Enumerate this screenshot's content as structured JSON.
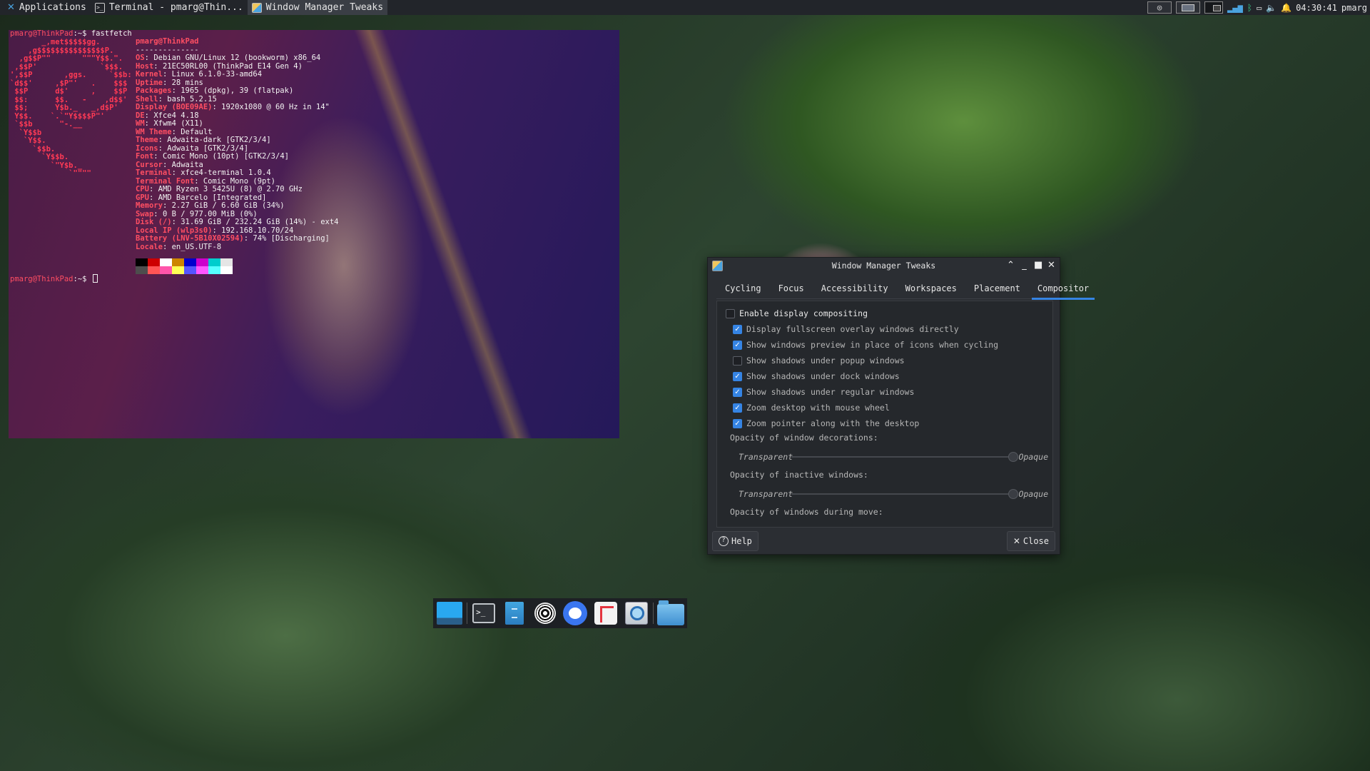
{
  "top_panel": {
    "applications": "Applications",
    "tasks": [
      {
        "label": "Terminal - pmarg@Thin...",
        "icon": "terminal-icon"
      },
      {
        "label": "Window Manager Tweaks",
        "icon": "window-manager-tweaks-icon"
      }
    ],
    "clock": "04:30:41",
    "user": "pmarg"
  },
  "terminal": {
    "prompt": "pmarg@ThinkPad",
    "path": ":~$",
    "command": "fastfetch",
    "logo": "       _,met$$$$$gg.\n    ,g$$$$$$$$$$$$$$$P.\n  ,g$$P\"\"       \"\"\"Y$$.\".\n ,$$P'              `$$$.\n',$$P       ,ggs.     `$$b:\n`d$$'     ,$P\"'   .    $$$\n $$P      d$'     ,    $$P\n $$:      $$.   -    ,d$$'\n $$;      Y$b._   _,d$P'\n Y$$.    `.`\"Y$$$$P\"'\n `$$b      \"-.__\n  `Y$$b\n   `Y$$.\n     `$$b.\n       `Y$$b.\n         `\"Y$b._\n             `\"\"\"\"",
    "user_host": "pmarg@ThinkPad",
    "separator": "--------------",
    "info": [
      {
        "key": "OS",
        "value": "Debian GNU/Linux 12 (bookworm) x86_64"
      },
      {
        "key": "Host",
        "value": "21EC50RL00 (ThinkPad E14 Gen 4)"
      },
      {
        "key": "Kernel",
        "value": "Linux 6.1.0-33-amd64"
      },
      {
        "key": "Uptime",
        "value": "28 mins"
      },
      {
        "key": "Packages",
        "value": "1965 (dpkg), 39 (flatpak)"
      },
      {
        "key": "Shell",
        "value": "bash 5.2.15"
      },
      {
        "key": "Display (BOE09AE)",
        "value": "1920x1080 @ 60 Hz in 14\""
      },
      {
        "key": "DE",
        "value": "Xfce4 4.18"
      },
      {
        "key": "WM",
        "value": "Xfwm4 (X11)"
      },
      {
        "key": "WM Theme",
        "value": "Default"
      },
      {
        "key": "Theme",
        "value": "Adwaita-dark [GTK2/3/4]"
      },
      {
        "key": "Icons",
        "value": "Adwaita [GTK2/3/4]"
      },
      {
        "key": "Font",
        "value": "Comic Mono (10pt) [GTK2/3/4]"
      },
      {
        "key": "Cursor",
        "value": "Adwaita"
      },
      {
        "key": "Terminal",
        "value": "xfce4-terminal 1.0.4"
      },
      {
        "key": "Terminal Font",
        "value": "Comic Mono (9pt)"
      },
      {
        "key": "CPU",
        "value": "AMD Ryzen 3 5425U (8) @ 2.70 GHz"
      },
      {
        "key": "GPU",
        "value": "AMD Barcelo [Integrated]"
      },
      {
        "key": "Memory",
        "value": "2.27 GiB / 6.60 GiB (34%)"
      },
      {
        "key": "Swap",
        "value": "0 B / 977.00 MiB (0%)"
      },
      {
        "key": "Disk (/)",
        "value": "31.69 GiB / 232.24 GiB (14%) - ext4"
      },
      {
        "key": "Local IP (wlp3s0)",
        "value": "192.168.10.70/24"
      },
      {
        "key": "Battery (LNV-5B10X02594)",
        "value": "74% [Discharging]"
      },
      {
        "key": "Locale",
        "value": "en_US.UTF-8"
      }
    ],
    "palette": [
      "#000000",
      "#cd0000",
      "#ffffff",
      "#cd8500",
      "#0000cd",
      "#cd00cd",
      "#00cdcd",
      "#e5e5e5",
      "#4d4d4d",
      "#ff5555",
      "#ff55aa",
      "#ffff55",
      "#5555ff",
      "#ff55ff",
      "#55ffff",
      "#ffffff"
    ]
  },
  "dialog": {
    "title": "Window Manager Tweaks",
    "tabs": [
      "Cycling",
      "Focus",
      "Accessibility",
      "Workspaces",
      "Placement",
      "Compositor"
    ],
    "active_tab": "Compositor",
    "enable": {
      "label": "Enable display compositing",
      "checked": false
    },
    "options": [
      {
        "label": "Display fullscreen overlay windows directly",
        "checked": true
      },
      {
        "label": "Show windows preview in place of icons when cycling",
        "checked": true
      },
      {
        "label": "Show shadows under popup windows",
        "checked": false
      },
      {
        "label": "Show shadows under dock windows",
        "checked": true
      },
      {
        "label": "Show shadows under regular windows",
        "checked": true
      },
      {
        "label": "Zoom desktop with mouse wheel",
        "checked": true
      },
      {
        "label": "Zoom pointer along with the desktop",
        "checked": true
      }
    ],
    "opacity_decorations_label": "Opacity of window decorations:",
    "opacity_inactive_label": "Opacity of inactive windows:",
    "opacity_move_label": "Opacity of windows during move:",
    "transparent": "Transparent",
    "opaque": "Opaque",
    "opacity_decorations_value": 1.0,
    "opacity_inactive_value": 1.0,
    "help": "Help",
    "close": "Close"
  },
  "dock": {
    "items": [
      "show-desktop-icon",
      "terminal-icon",
      "file-cabinet-icon",
      "tor-browser-icon",
      "signal-icon",
      "flag-app-icon",
      "app-finder-icon",
      "folder-icon"
    ]
  },
  "colors": {
    "accent": "#3584e4",
    "prompt": "#ff4e63",
    "panel_bg": "#22252a",
    "dialog_bg": "#2b2e33"
  }
}
